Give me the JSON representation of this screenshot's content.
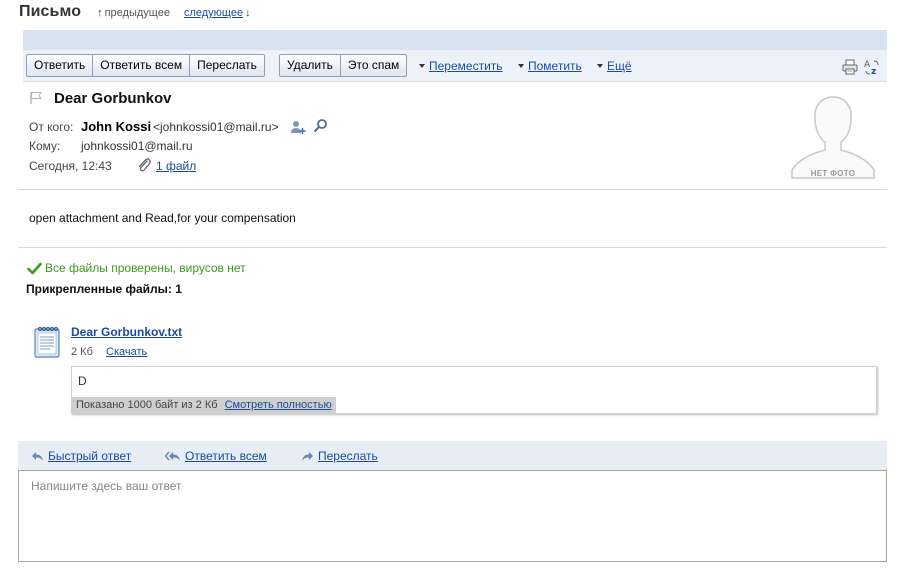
{
  "page": {
    "title": "Письмо",
    "nav_prev": "предыдущее",
    "nav_next": "следующее"
  },
  "toolbar": {
    "reply": "Ответить",
    "reply_all": "Ответить всем",
    "forward": "Переслать",
    "delete": "Удалить",
    "spam": "Это спам",
    "move": "Переместить",
    "mark": "Пометить",
    "more": "Ещё",
    "icons": [
      "print-icon",
      "translate-icon"
    ]
  },
  "message": {
    "subject": "Dear Gorbunkov",
    "from_label": "От кого:",
    "from_name": "John Kossi",
    "from_email": "<johnkossi01@mail.ru>",
    "to_label": "Кому:",
    "to_email": "johnkossi01@mail.ru",
    "date": "Сегодня, 12:43",
    "files_link": "1 файл",
    "no_photo": "НЕТ ФОТО",
    "body": "open attachment and Read,for your compensation"
  },
  "attachments": {
    "virus_status": "Все файлы проверены, вирусов нет",
    "header": "Прикрепленные файлы: 1",
    "files": [
      {
        "name": "Dear Gorbunkov.txt",
        "size": "2 Кб",
        "download": "Скачать",
        "preview_text": "D",
        "preview_info": "Показано 1000 байт из 2 Кб",
        "preview_full": "Смотреть полностью"
      }
    ]
  },
  "quick_reply": {
    "quick": "Быстрый ответ",
    "reply_all": "Ответить всем",
    "forward": "Переслать",
    "placeholder": "Напишите здесь ваш ответ"
  },
  "colors": {
    "link": "#1a4b9c",
    "virus_ok": "#3d9b1b",
    "toolbar_bg": "#edf2f8",
    "strip_bg": "#d7e3f0"
  }
}
